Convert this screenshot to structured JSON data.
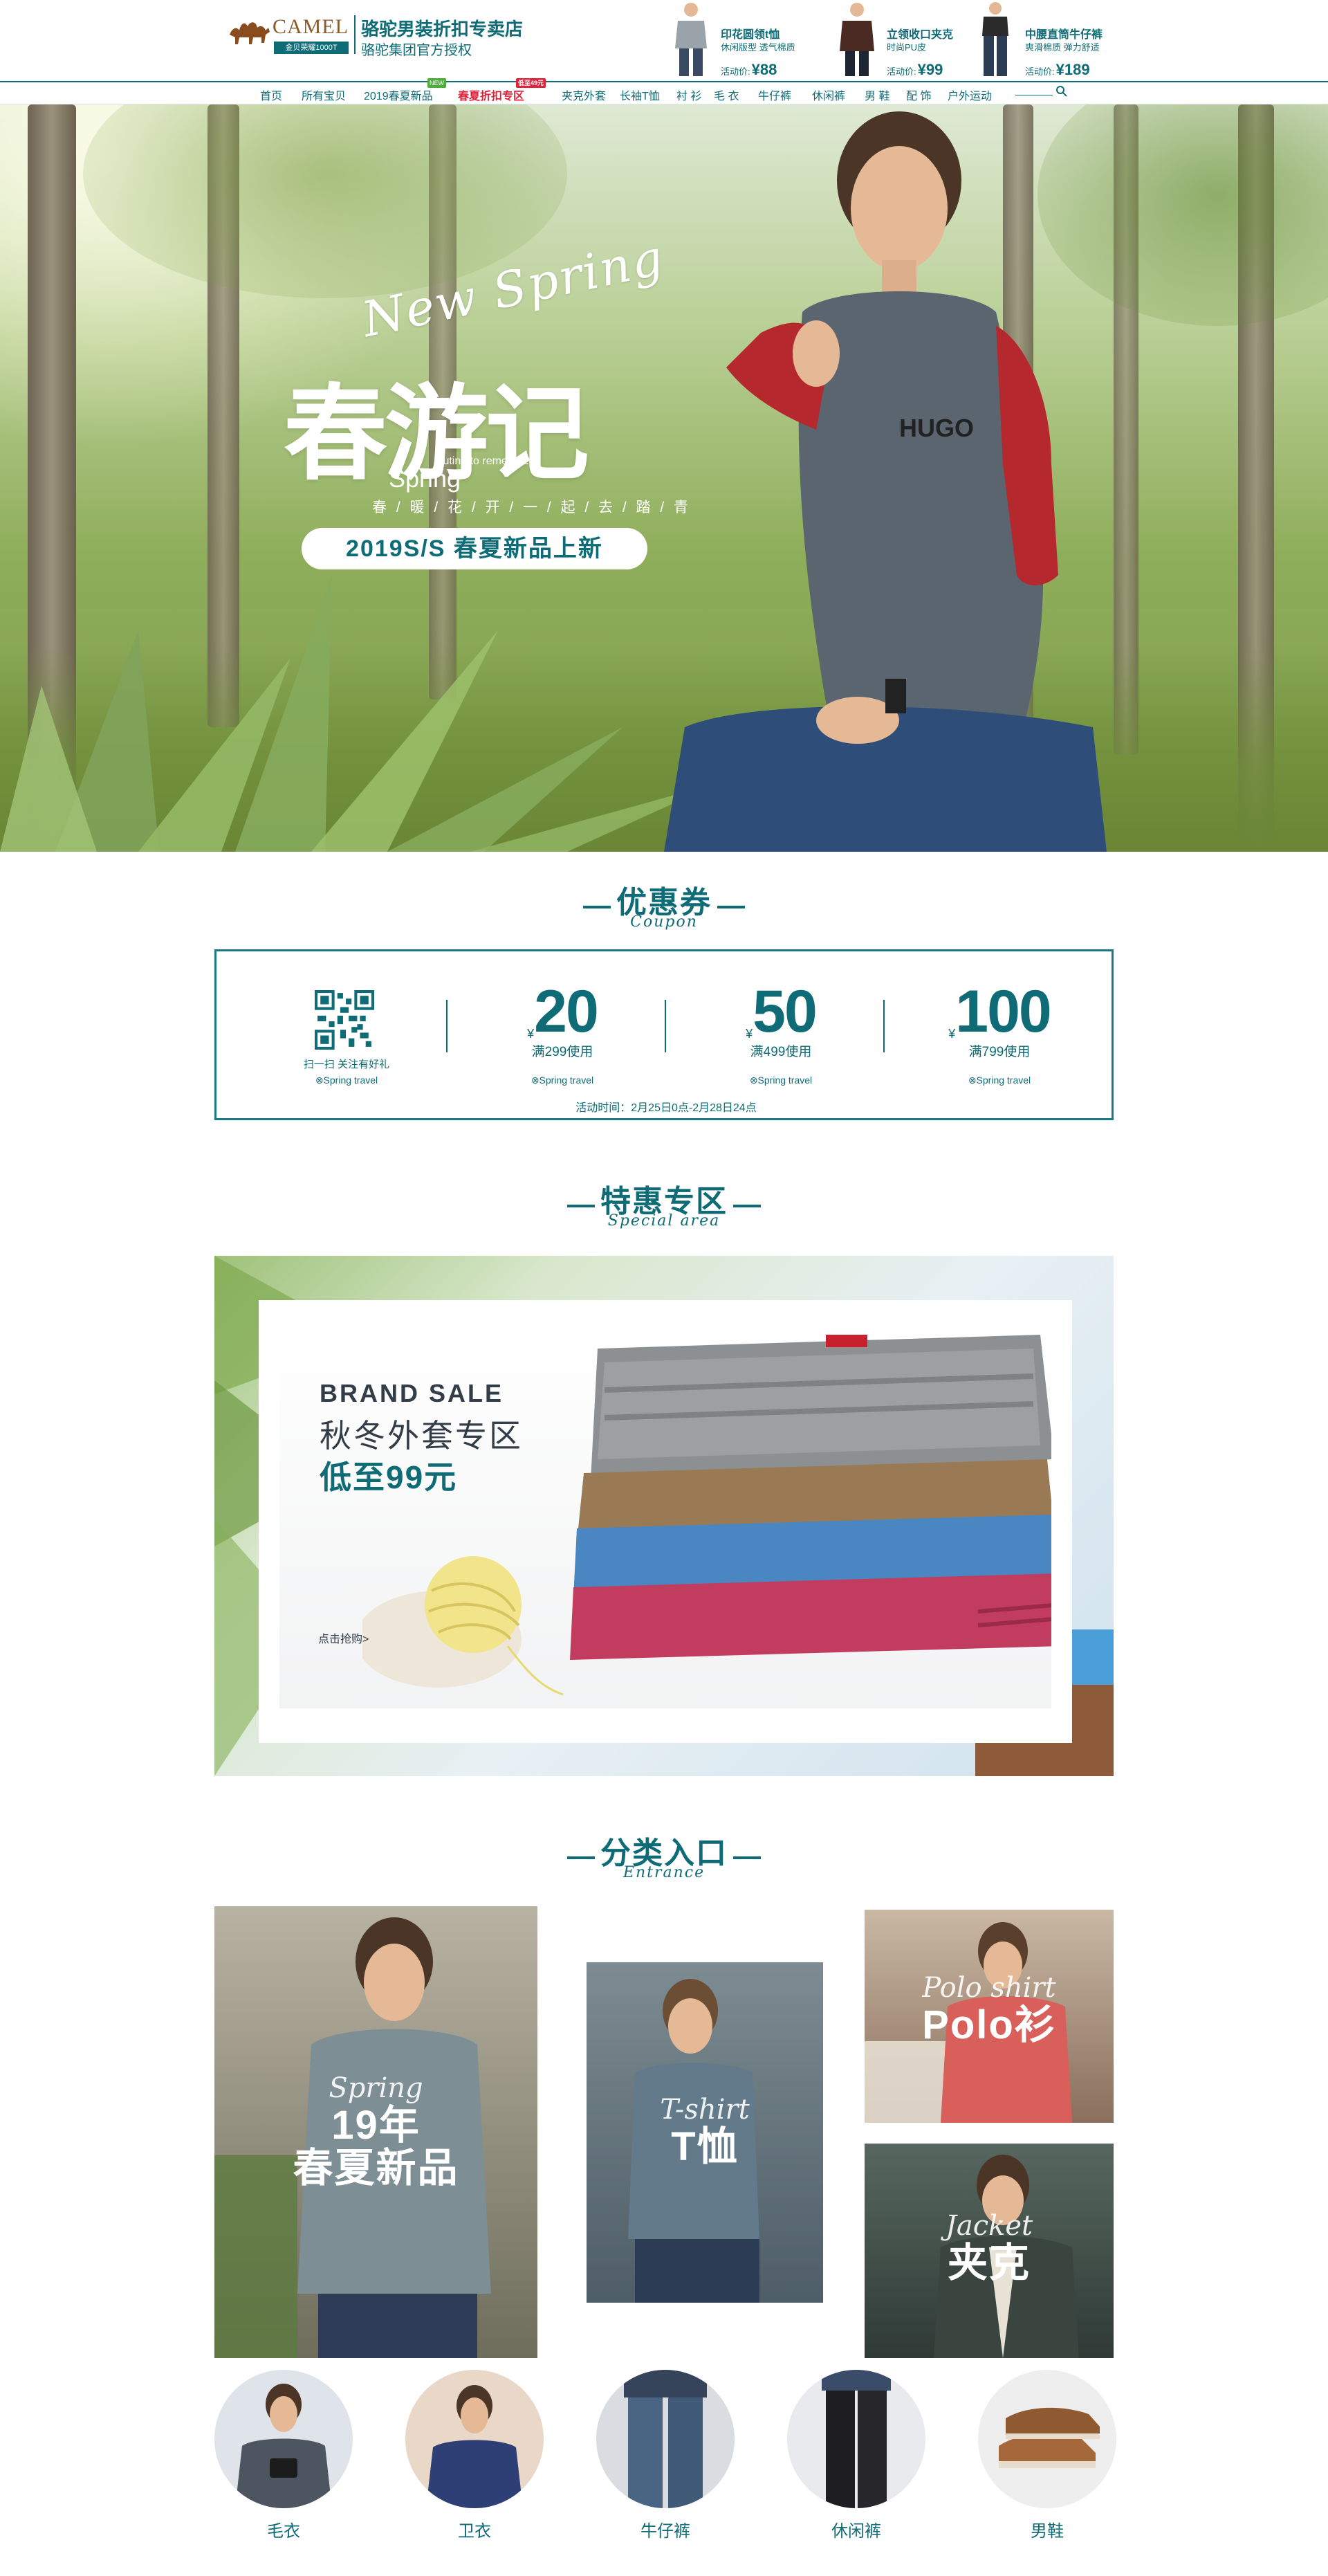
{
  "brand": {
    "logo_word": "CAMEL",
    "logo_sub": "金贝荣耀1000T",
    "store_name": "骆驼男装折扣专卖店",
    "store_sub": "骆驼集团官方授权"
  },
  "header_products": [
    {
      "title": "印花圆领t恤",
      "desc": "休闲版型 透气棉质",
      "price_label": "活动价:",
      "price": "¥88",
      "shirt_color": "#9aa3a9"
    },
    {
      "title": "立领收口夹克",
      "desc": "时尚PU皮",
      "price_label": "活动价:",
      "price": "¥99",
      "shirt_color": "#4a2a22"
    },
    {
      "title": "中腰直筒牛仔裤",
      "desc": "爽滑棉质  弹力舒适",
      "price_label": "活动价:",
      "price": "¥189",
      "shirt_color": "#2c3c55"
    }
  ],
  "nav": {
    "items": [
      "首页",
      "所有宝贝",
      "2019春夏新品",
      "春夏折扣专区",
      "夹克外套",
      "长袖T恤",
      "衬 衫",
      "毛 衣",
      "牛仔裤",
      "休闲裤",
      "男 鞋",
      "配 饰",
      "户外运动"
    ],
    "badge_new": "NEW",
    "badge_sale": "低至49元",
    "active_index": 3
  },
  "hero": {
    "script": "New Spring",
    "title": "春游记",
    "tag_en": "Outing to remember",
    "spring": "Spring",
    "subtitle": "春 / 暖 / 花 / 开 / 一 / 起 / 去 / 踏 / 青",
    "pill": "2019S/S 春夏新品上新"
  },
  "coupon_section": {
    "title": "优惠券",
    "title_en": "Coupon",
    "qr_text": "扫一扫 关注有好礼",
    "spring_note": "⊗Spring travel",
    "coupons": [
      {
        "yen": "¥",
        "value": "20",
        "condition": "满299使用"
      },
      {
        "yen": "¥",
        "value": "50",
        "condition": "满499使用"
      },
      {
        "yen": "¥",
        "value": "100",
        "condition": "满799使用"
      }
    ],
    "time": "活动时间：2月25日0点-2月28日24点"
  },
  "special_section": {
    "title": "特惠专区",
    "title_en": "Special area",
    "brand_sale": "BRAND SALE",
    "headline": "秋冬外套专区",
    "price": "低至99元",
    "cta": "点击抢购>"
  },
  "entrance_section": {
    "title": "分类入口",
    "title_en": "Entrance",
    "cards": [
      {
        "script": "Spring",
        "line1": "19年",
        "line2": "春夏新品"
      },
      {
        "script": "T-shirt",
        "line1": "T恤",
        "line2": ""
      },
      {
        "script": "Polo shirt",
        "line1": "Polo衫",
        "line2": ""
      },
      {
        "script": "Jacket",
        "line1": "夹克",
        "line2": ""
      }
    ],
    "round_items": [
      "毛衣",
      "卫衣",
      "牛仔裤",
      "休闲裤",
      "男鞋"
    ]
  },
  "colors": {
    "accent": "#0f6b75",
    "sale_red": "#e0223a",
    "new_green": "#4caf3a"
  }
}
